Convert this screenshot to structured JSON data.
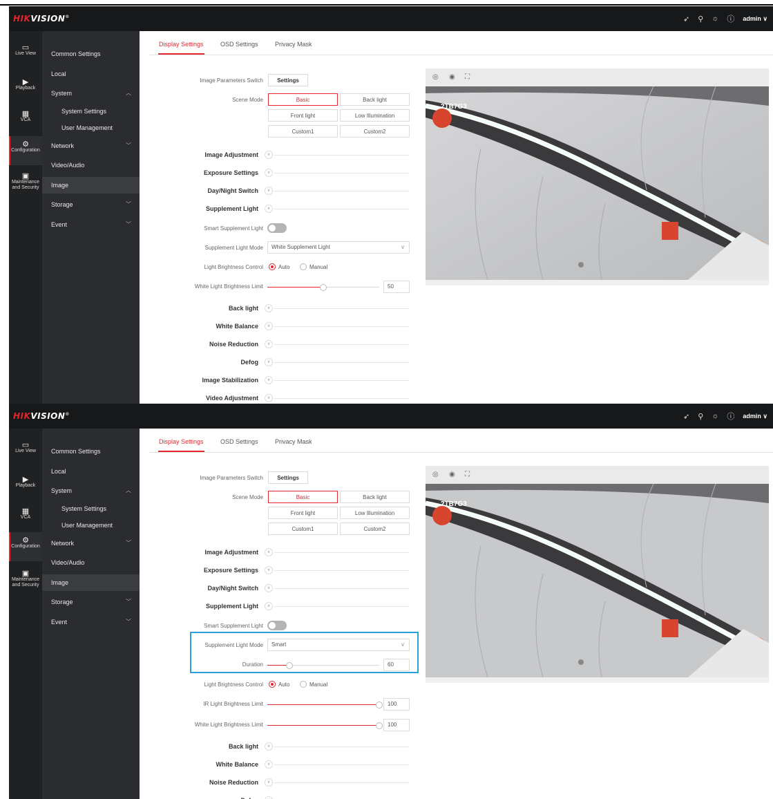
{
  "brand": {
    "logo_red": "HIK",
    "logo_white": "VISION",
    "reg": "®"
  },
  "header": {
    "user": "admin ∨",
    "icons": [
      "send-icon",
      "search-icon",
      "bulb-icon",
      "info-icon"
    ]
  },
  "rail": {
    "items": [
      "Live View",
      "Playback",
      "VCA",
      "Configuration",
      "Maintenance and Security"
    ]
  },
  "menu": {
    "common": "Common Settings",
    "local": "Local",
    "system": "System",
    "system_settings": "System Settings",
    "user_management": "User Management",
    "network": "Network",
    "video_audio": "Video/Audio",
    "image": "Image",
    "storage": "Storage",
    "event": "Event"
  },
  "tabs": [
    "Display Settings",
    "OSD Settings",
    "Privacy Mask"
  ],
  "form": {
    "image_params_switch": "Image Parameters Switch",
    "settings_btn": "Settings",
    "scene_mode": "Scene Mode",
    "scenes": [
      "Basic",
      "Back light",
      "Front light",
      "Low Illumination",
      "Custom1",
      "Custom2"
    ],
    "image_adjustment": "Image Adjustment",
    "exposure_settings": "Exposure Settings",
    "day_night_switch": "Day/Night Switch",
    "supplement_light": "Supplement Light",
    "smart_supplement_light": "Smart Supplement Light",
    "supplement_light_mode": "Supplement Light Mode",
    "light_brightness_control": "Light Brightness Control",
    "auto": "Auto",
    "manual": "Manual",
    "white_light_limit": "White Light Brightness Limit",
    "ir_light_limit": "IR Light Brightness Limit",
    "duration": "Duration",
    "back_light": "Back light",
    "white_balance": "White Balance",
    "noise_reduction": "Noise Reduction",
    "defog": "Defog",
    "image_stabilization": "Image Stabilization",
    "video_adjustment": "Video Adjustment"
  },
  "panel1": {
    "mode_value": "White Supplement Light",
    "white_limit_value": "50",
    "white_limit_level": 0.5
  },
  "panel2": {
    "mode_value": "Smart",
    "duration_value": "60",
    "duration_level": 0.2,
    "ir_limit_value": "100",
    "ir_limit_level": 1.0,
    "white_limit_value": "100",
    "white_limit_level": 1.0
  },
  "preview": {
    "overlay_text": "2TB7G3",
    "tool_icons": [
      "snapshot-icon",
      "record-icon",
      "fullscreen-icon"
    ]
  },
  "colors": {
    "accent": "#e3262c",
    "highlight": "#2a9fd8",
    "header": "#17181a",
    "menu": "#2b2c2f"
  }
}
